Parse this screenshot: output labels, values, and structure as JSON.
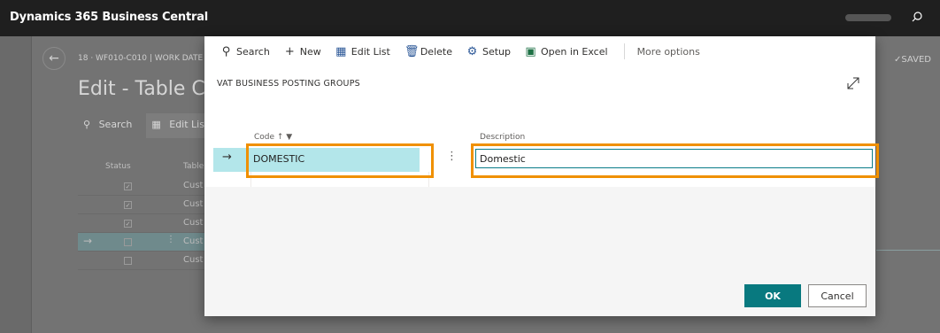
{
  "app": {
    "title": "Dynamics 365 Business Central"
  },
  "background_page": {
    "breadcrumb": "18 · WF010-C010 | WORK DATE",
    "title": "Edit - Table Co",
    "saved_label": "✓SAVED",
    "toolbar": {
      "search_label": "Search",
      "edit_list_label": "Edit List"
    },
    "columns": {
      "status": "Status",
      "table": "Table"
    },
    "rows": [
      {
        "checked": "✓",
        "text": "Cust"
      },
      {
        "checked": "✓",
        "text": "Cust"
      },
      {
        "checked": "✓",
        "text": "Cust"
      },
      {
        "checked": "",
        "text": "Cust"
      },
      {
        "checked": "",
        "text": "Cust"
      }
    ]
  },
  "dialog": {
    "toolbar": {
      "search": "Search",
      "new": "New",
      "edit_list": "Edit List",
      "delete": "Delete",
      "setup": "Setup",
      "open_in_excel": "Open in Excel",
      "more_options": "More options"
    },
    "caption": "VAT BUSINESS POSTING GROUPS",
    "columns": {
      "code": "Code ↑ ▼",
      "description": "Description"
    },
    "row": {
      "code": "DOMESTIC",
      "description": "Domestic"
    },
    "buttons": {
      "ok": "OK",
      "cancel": "Cancel"
    }
  },
  "colors": {
    "appbar": "#1f1f1f",
    "accent": "#08797f",
    "selected_row": "#b3e6ea",
    "highlight": "#f09000"
  }
}
